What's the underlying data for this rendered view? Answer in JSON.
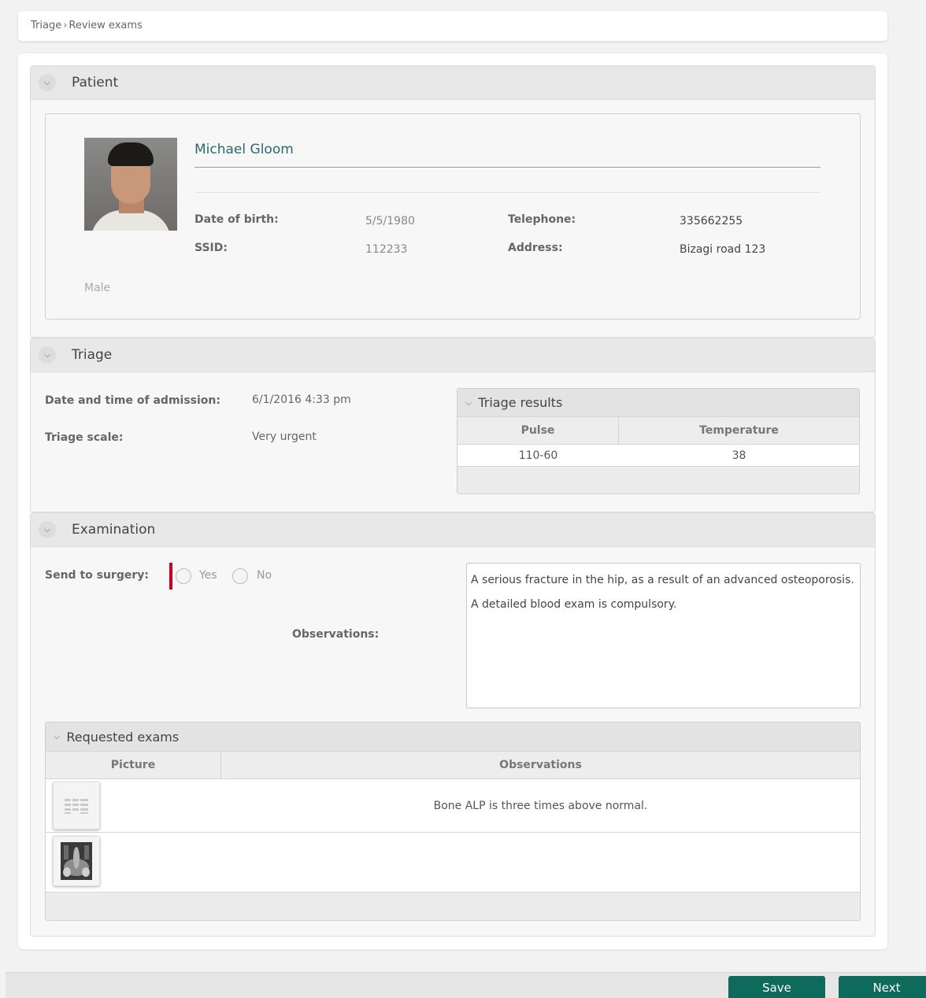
{
  "breadcrumb": {
    "root": "Triage",
    "separator": "›",
    "current": "Review exams"
  },
  "patient": {
    "section_title": "Patient",
    "name": "Michael Gloom",
    "dob_label": "Date of birth:",
    "dob_value": "5/5/1980",
    "ssid_label": "SSID:",
    "ssid_value": "112233",
    "telephone_label": "Telephone:",
    "telephone_value": "335662255",
    "address_label": "Address:",
    "address_value": "Bizagi road 123",
    "gender": "Male"
  },
  "triage": {
    "section_title": "Triage",
    "admission_label": "Date and time of admission:",
    "admission_value": "6/1/2016 4:33 pm",
    "scale_label": "Triage scale:",
    "scale_value": "Very urgent",
    "results": {
      "title": "Triage results",
      "columns": [
        "Pulse",
        "Temperature"
      ],
      "rows": [
        [
          "110-60",
          "38"
        ]
      ]
    }
  },
  "examination": {
    "section_title": "Examination",
    "surgery_label": "Send to surgery:",
    "option_yes": "Yes",
    "option_no": "No",
    "observations_label": "Observations:",
    "observations_text": "A serious fracture in the hip, as a result of an advanced osteoporosis. A detailed blood exam is compulsory.",
    "requested_exams": {
      "title": "Requested exams",
      "columns": [
        "Picture",
        "Observations"
      ],
      "rows": [
        {
          "picture": "lab-report-thumbnail",
          "observation": "Bone ALP is three times above normal."
        },
        {
          "picture": "xray-thumbnail",
          "observation": ""
        }
      ]
    }
  },
  "footer": {
    "save_label": "Save",
    "next_label": "Next"
  },
  "colors": {
    "accent": "#0e6b5c",
    "name_color": "#2a6b6b",
    "required": "#d0021b"
  }
}
